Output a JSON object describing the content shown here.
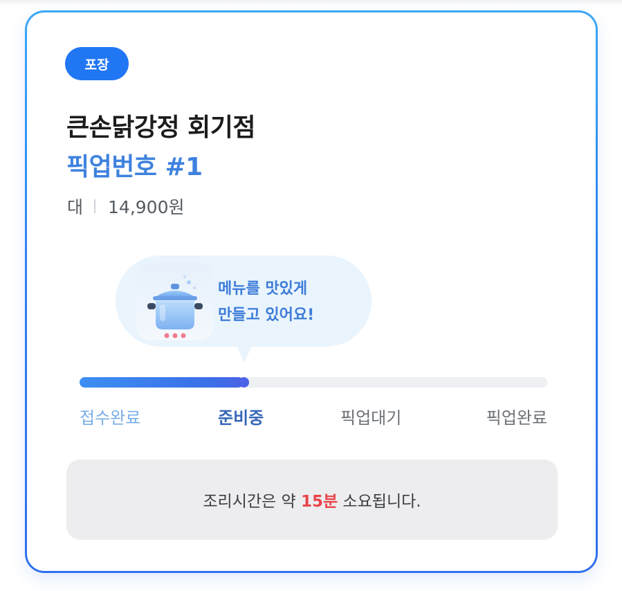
{
  "order_type_badge": "포장",
  "store_name": "큰손닭강정 회기점",
  "pickup_number": "픽업번호 #1",
  "order_summary": {
    "size": "대",
    "price": "14,900원"
  },
  "status_bubble": {
    "line1": "메뉴를 맛있게",
    "line2": "만들고 있어요!",
    "icon": "cooking-pot-icon"
  },
  "progress": {
    "fraction": 0.35,
    "current_step_index": 1,
    "steps": [
      {
        "label": "접수완료",
        "state": "done"
      },
      {
        "label": "준비중",
        "state": "current"
      },
      {
        "label": "픽업대기",
        "state": "pending"
      },
      {
        "label": "픽업완료",
        "state": "pending"
      }
    ]
  },
  "cooking_time": {
    "prefix": "조리시간은 약 ",
    "value": "15분",
    "suffix": " 소요됩니다."
  },
  "colors": {
    "accent": "#2176f3",
    "pickup_text": "#3f82de",
    "highlight_red": "#e8454b",
    "bubble_bg": "#e9f4fd"
  }
}
